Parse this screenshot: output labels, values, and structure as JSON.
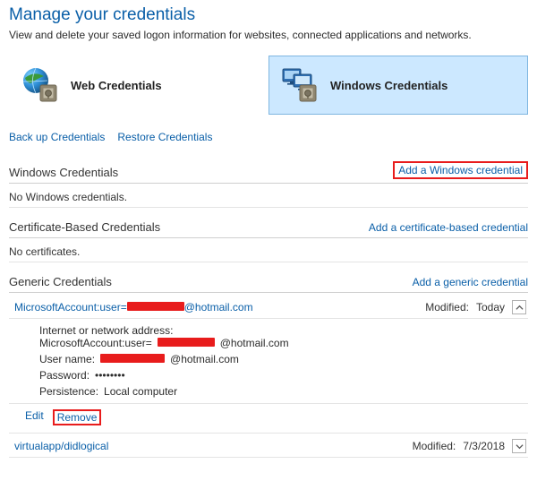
{
  "header": {
    "title": "Manage your credentials",
    "subtitle": "View and delete your saved logon information for websites, connected applications and networks."
  },
  "categories": {
    "web_label": "Web Credentials",
    "win_label": "Windows Credentials"
  },
  "links": {
    "backup": "Back up Credentials",
    "restore": "Restore Credentials"
  },
  "sections": {
    "windows": {
      "title": "Windows Credentials",
      "add_label": "Add a Windows credential",
      "empty_msg": "No Windows credentials."
    },
    "cert": {
      "title": "Certificate-Based Credentials",
      "add_label": "Add a certificate-based credential",
      "empty_msg": "No certificates."
    },
    "generic": {
      "title": "Generic Credentials",
      "add_label": "Add a generic credential"
    }
  },
  "modified_label": "Modified:",
  "details_labels": {
    "address": "Internet or network address:",
    "username": "User name:",
    "password": "Password:",
    "persistence": "Persistence:"
  },
  "generic_entries": {
    "ms": {
      "title_prefix": "MicrosoftAccount:user=",
      "title_suffix": "@hotmail.com",
      "modified": "Today",
      "address_prefix": "MicrosoftAccount:user=",
      "address_suffix": "@hotmail.com",
      "username_suffix": "@hotmail.com",
      "password_masked": "••••••••",
      "persistence": "Local computer"
    },
    "virtualapp": {
      "title": "virtualapp/didlogical",
      "modified": "7/3/2018"
    }
  },
  "actions": {
    "edit": "Edit",
    "remove": "Remove"
  }
}
